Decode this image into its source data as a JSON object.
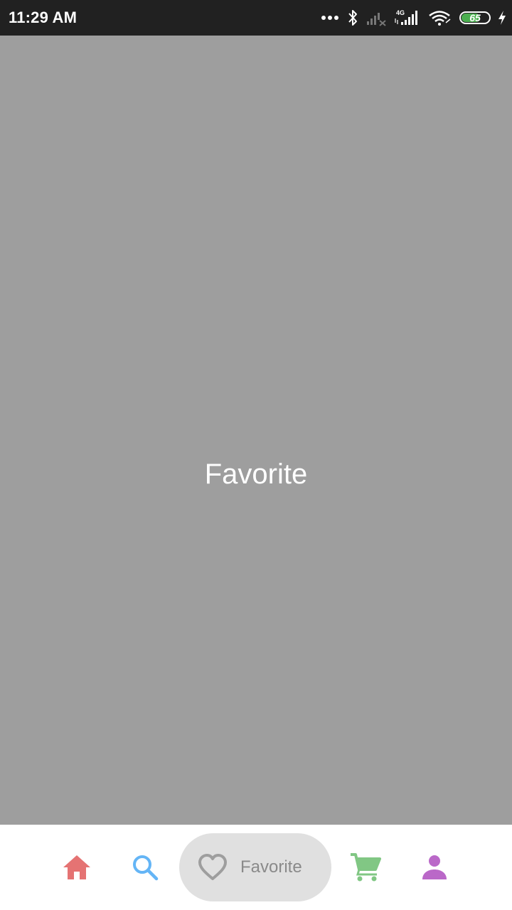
{
  "status_bar": {
    "time": "11:29 AM",
    "battery_level": "65",
    "network_type": "4G"
  },
  "main": {
    "title": "Favorite"
  },
  "bottom_nav": {
    "items": [
      {
        "icon": "home-icon",
        "color": "#e57373"
      },
      {
        "icon": "search-icon",
        "color": "#64b5f6"
      },
      {
        "icon": "heart-icon",
        "label": "Favorite",
        "color": "#9e9e9e",
        "selected": true
      },
      {
        "icon": "cart-icon",
        "color": "#81c784"
      },
      {
        "icon": "person-icon",
        "color": "#ba68c8"
      }
    ]
  },
  "colors": {
    "status_bar_bg": "#212121",
    "content_bg": "#9e9e9e",
    "nav_bg": "#ffffff",
    "selected_pill_bg": "#e0e0e0"
  }
}
